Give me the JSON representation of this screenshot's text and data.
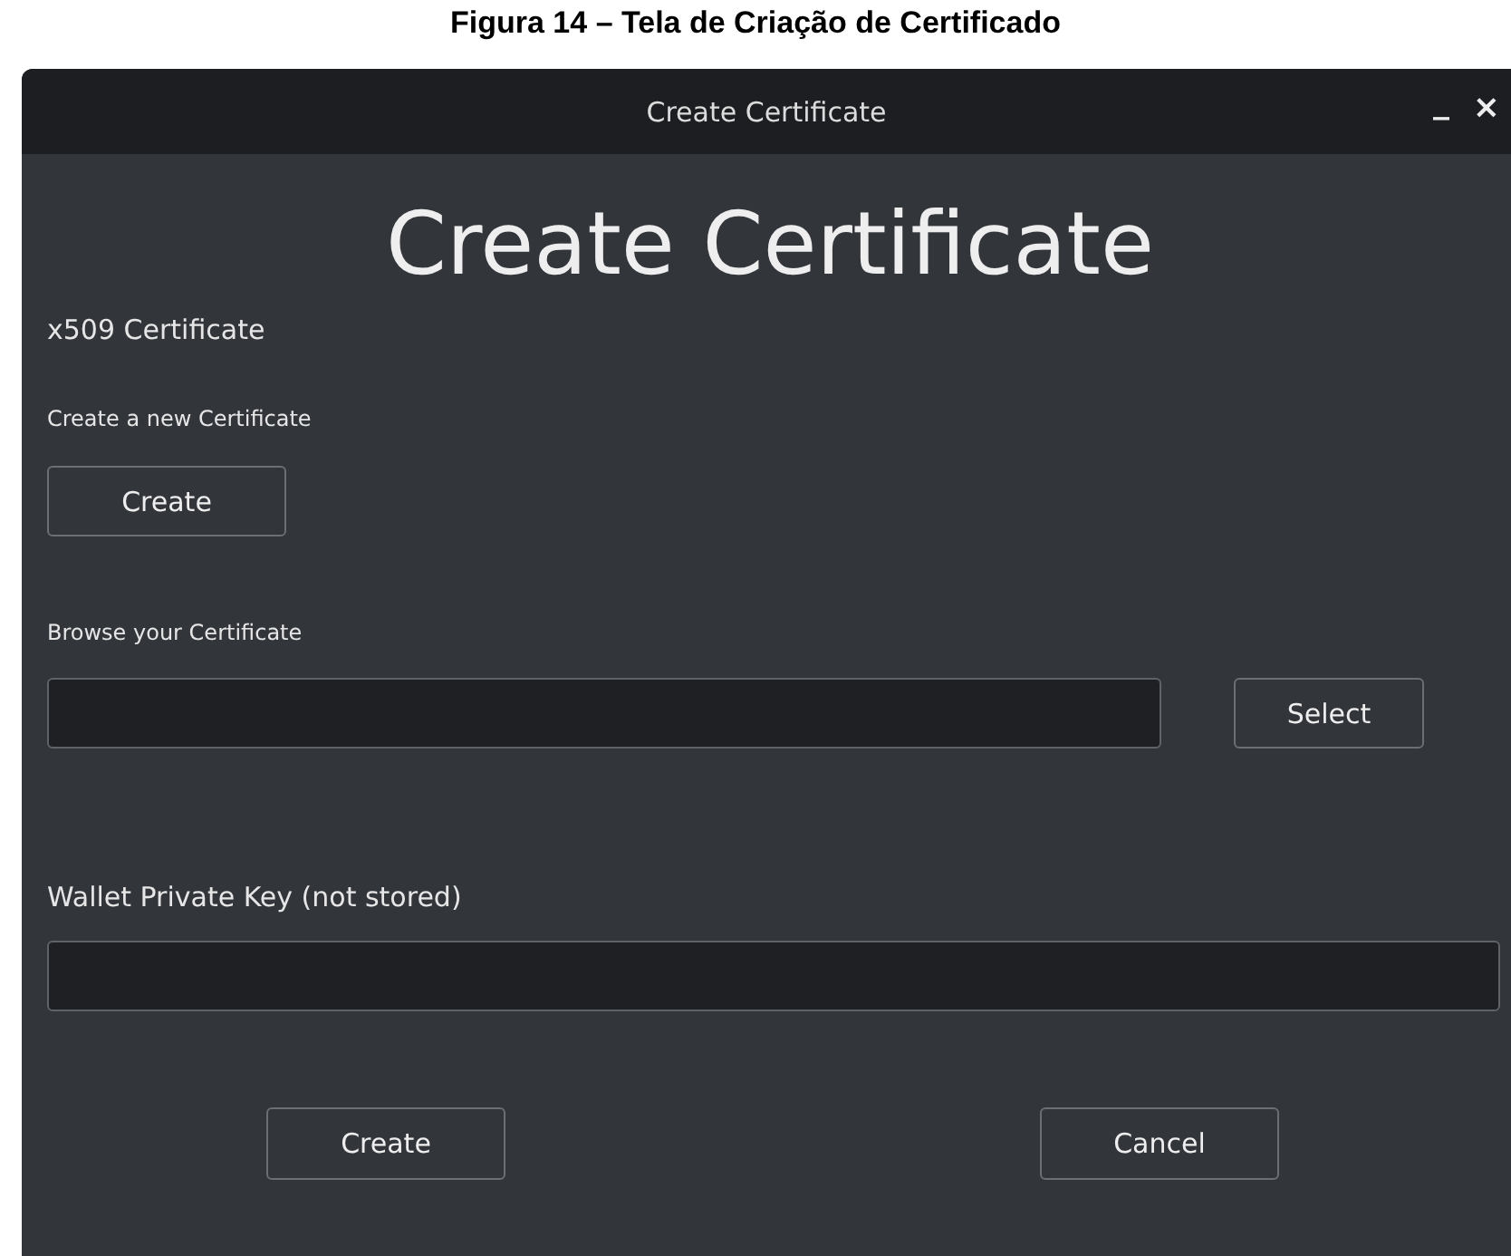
{
  "caption": "Figura 14 – Tela de Criação de Certificado",
  "window": {
    "title": "Create Certificate",
    "minimize": "_",
    "close": "×"
  },
  "heading": "Create Certificate",
  "section_title": "x509 Certificate",
  "create_label": "Create a new Certificate",
  "create_button": "Create",
  "browse_label": "Browse your Certificate",
  "select_button": "Select",
  "key_label": "Wallet Private Key (not stored)",
  "buttons": [
    "Create",
    "Cancel"
  ]
}
